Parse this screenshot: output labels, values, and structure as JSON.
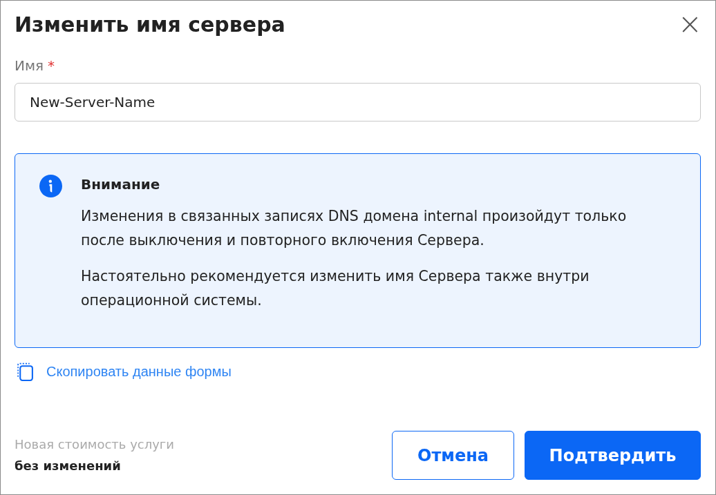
{
  "dialog": {
    "title": "Изменить имя сервера",
    "close": "×"
  },
  "field": {
    "label": "Имя",
    "required": true,
    "required_mark": "*",
    "value": "New-Server-Name"
  },
  "notice": {
    "title": "Внимание",
    "paragraphs": [
      "Изменения в связанных записях DNS домена internal произойдут только после выключения и повторного включения Сервера.",
      "Настоятельно рекомендуется изменить имя Сервера также внутри операционной системы."
    ]
  },
  "copy_link": "Скопировать данные формы",
  "price": {
    "label": "Новая стоимость услуги",
    "value": "без изменений"
  },
  "buttons": [
    {
      "label": "Отмена",
      "kind": "secondary"
    },
    {
      "label": "Подтвердить",
      "kind": "primary"
    }
  ]
}
